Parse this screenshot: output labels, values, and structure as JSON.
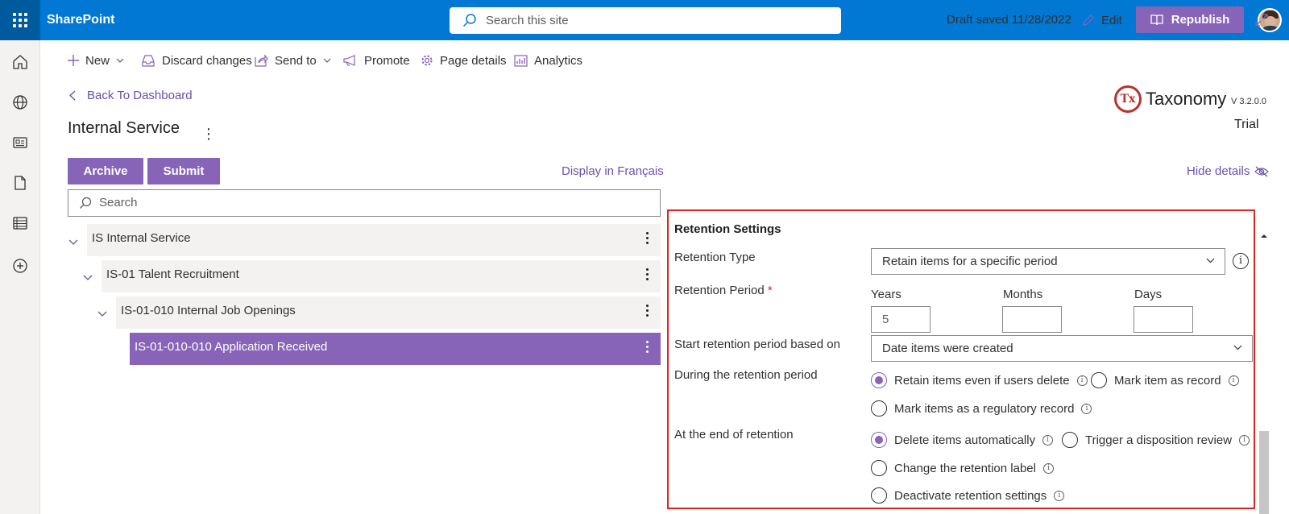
{
  "app": {
    "name": "SharePoint"
  },
  "search": {
    "placeholder": "Search this site"
  },
  "command_bar": {
    "new": "New",
    "discard": "Discard changes",
    "send_to": "Send to",
    "promote": "Promote",
    "page_details": "Page details",
    "analytics": "Analytics",
    "draft_status": "Draft saved 11/28/2022",
    "edit": "Edit",
    "republish": "Republish"
  },
  "nav": {
    "back": "Back To Dashboard"
  },
  "page": {
    "title": "Internal Service"
  },
  "brand": {
    "logo_letters": "Tx",
    "name": "Taxonomy",
    "version": "V 3.2.0.0",
    "license": "Trial"
  },
  "actions": {
    "archive": "Archive",
    "submit": "Submit",
    "display_language": "Display in Français",
    "hide_details": "Hide details"
  },
  "tree": {
    "search_placeholder": "Search",
    "items": [
      {
        "label": "IS Internal Service",
        "level": 0,
        "selected": false
      },
      {
        "label": "IS-01 Talent Recruitment",
        "level": 1,
        "selected": false
      },
      {
        "label": "IS-01-010 Internal Job Openings",
        "level": 2,
        "selected": false
      },
      {
        "label": "IS-01-010-010 Application Received",
        "level": 3,
        "selected": true
      }
    ]
  },
  "retention": {
    "heading": "Retention Settings",
    "type_label": "Retention Type",
    "type_value": "Retain items for a specific period",
    "period_label": "Retention Period",
    "period_required": "*",
    "years_label": "Years",
    "years_value": "5",
    "months_label": "Months",
    "months_value": "",
    "days_label": "Days",
    "days_value": "",
    "start_label": "Start retention period based on",
    "start_value": "Date items were created",
    "during_label": "During the retention period",
    "during_options": [
      {
        "label": "Retain items even if users delete",
        "selected": true
      },
      {
        "label": "Mark item as record",
        "selected": false
      },
      {
        "label": "Mark items as a regulatory record",
        "selected": false
      }
    ],
    "end_label": "At the end of retention",
    "end_options": [
      {
        "label": "Delete items automatically",
        "selected": true
      },
      {
        "label": "Trigger a disposition review",
        "selected": false
      },
      {
        "label": "Change the retention label",
        "selected": false
      },
      {
        "label": "Deactivate retention settings",
        "selected": false
      }
    ]
  },
  "colors": {
    "header": "#0078d4",
    "accent": "#8764b8",
    "link": "#6b4fb0",
    "highlight_border": "#e02424"
  }
}
